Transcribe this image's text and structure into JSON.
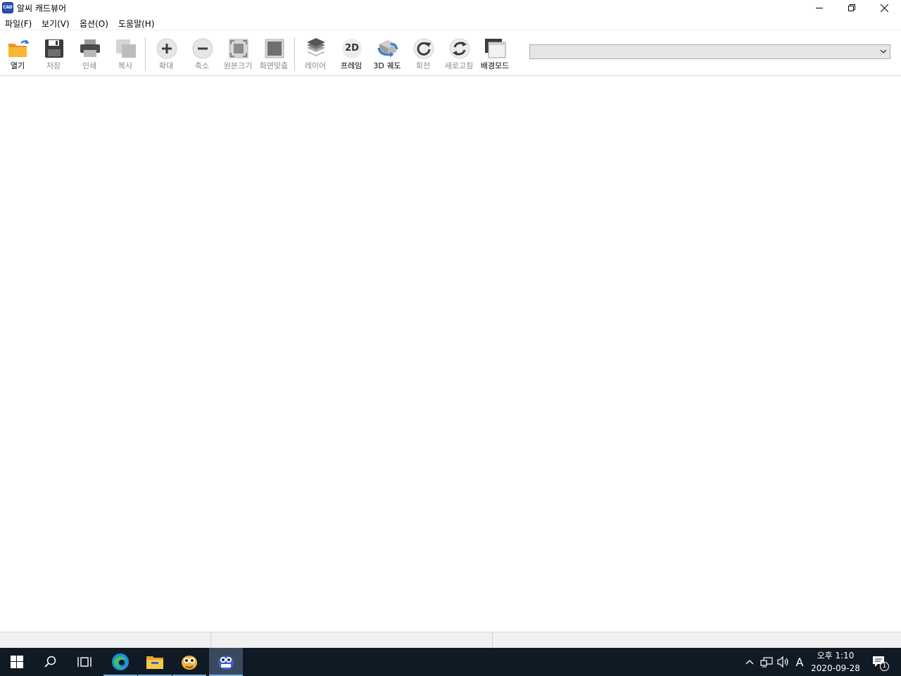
{
  "window": {
    "title": "알씨 캐드뷰어",
    "icon_text": "CAD"
  },
  "menu": [
    {
      "label": "파일(F)"
    },
    {
      "label": "보기(V)"
    },
    {
      "label": "옵션(O)"
    },
    {
      "label": "도움말(H)"
    }
  ],
  "toolbar": {
    "buttons": [
      {
        "label": "열기",
        "icon": "open-folder-icon",
        "enabled": true
      },
      {
        "label": "저장",
        "icon": "save-icon",
        "enabled": false
      },
      {
        "label": "인쇄",
        "icon": "print-icon",
        "enabled": false
      },
      {
        "label": "복사",
        "icon": "copy-icon",
        "enabled": false
      },
      {
        "label": "확대",
        "icon": "zoom-in-icon",
        "enabled": false
      },
      {
        "label": "축소",
        "icon": "zoom-out-icon",
        "enabled": false
      },
      {
        "label": "원본크기",
        "icon": "original-size-icon",
        "enabled": false
      },
      {
        "label": "화면맞춤",
        "icon": "fit-screen-icon",
        "enabled": false
      },
      {
        "label": "레이어",
        "icon": "layers-icon",
        "enabled": false
      },
      {
        "label": "프레임",
        "icon": "2d-frame-icon",
        "enabled": true,
        "icon_text": "2D"
      },
      {
        "label": "3D 궤도",
        "icon": "3d-orbit-icon",
        "enabled": true
      },
      {
        "label": "회전",
        "icon": "rotate-icon",
        "enabled": false
      },
      {
        "label": "새로고침",
        "icon": "refresh-icon",
        "enabled": false
      },
      {
        "label": "배경모드",
        "icon": "background-mode-icon",
        "enabled": true
      }
    ],
    "layout_select": {
      "value": ""
    }
  },
  "statusbar": {
    "panes": [
      "",
      "",
      ""
    ]
  },
  "taskbar": {
    "apps": [
      {
        "name": "start-icon"
      },
      {
        "name": "search-icon"
      },
      {
        "name": "task-view-icon"
      },
      {
        "name": "edge-icon"
      },
      {
        "name": "file-explorer-icon"
      },
      {
        "name": "alsee-app-icon"
      },
      {
        "name": "cad-viewer-app-icon"
      }
    ],
    "ime": "A",
    "clock_time": "오후 1:10",
    "clock_date": "2020-09-28",
    "notification_count": "1"
  },
  "colors": {
    "taskbar": "#101a24",
    "accent": "#76b9ed",
    "folder": "#f5a623"
  }
}
